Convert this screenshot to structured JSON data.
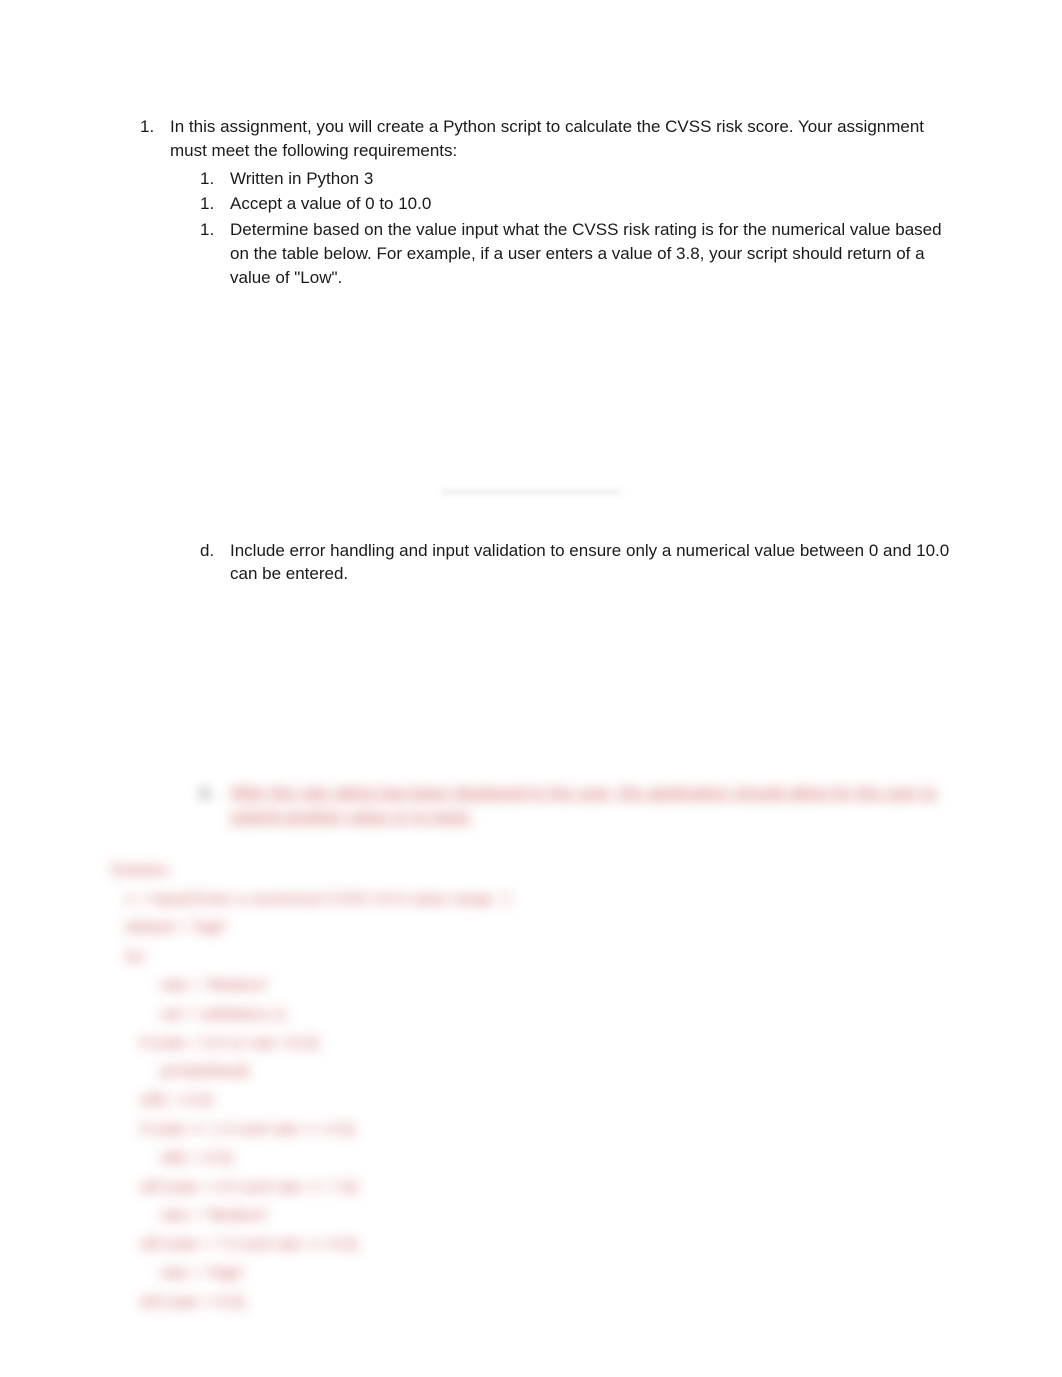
{
  "main": {
    "marker": "1.",
    "intro": "In this assignment, you will create a Python script to calculate the CVSS risk score. Your assignment must meet the following requirements:",
    "subs": [
      {
        "marker": "1.",
        "text": "Written in Python 3"
      },
      {
        "marker": "1.",
        "text": "Accept a value of 0 to 10.0"
      },
      {
        "marker": "1.",
        "text": "Determine based on the value input what the CVSS risk rating is for the numerical value based on the table below. For example, if a user enters a value of 3.8, your script should return of a value of \"Low\"."
      }
    ]
  },
  "section_d": {
    "marker": "d.",
    "text": "Include error handling and input validation to ensure only a numerical value between 0 and 10.0 can be entered."
  },
  "blurred_e": {
    "marker": "e.",
    "text": "After the rule rating has been displayed to the user, the application should allow for the user to submit another value or to input."
  },
  "code": {
    "lines": [
      {
        "indent": 0,
        "text": "Solution:"
      },
      {
        "indent": 1,
        "text": "x = input('Enter a numerical CVSS V3.0 value range :')"
      },
      {
        "indent": 1,
        "text": "default = 'high'"
      },
      {
        "indent": 1,
        "text": "try:"
      },
      {
        "indent": 3,
        "text": "rate = 'Medium'"
      },
      {
        "indent": 3,
        "text": "val = validate(x,1)"
      },
      {
        "indent": 2,
        "text": "if (rate = 0.0 or rate <0.0):"
      },
      {
        "indent": 3,
        "text": "print(default)"
      },
      {
        "indent": 2,
        "text": "elif( = 0.0):"
      },
      {
        "indent": 2,
        "text": "if (rate >= 1.0 and rate <= 4.0):"
      },
      {
        "indent": 3,
        "text": "elif( = 0.0):"
      },
      {
        "indent": 2,
        "text": "elif (rate > 4.0 and rate <= 7.0):"
      },
      {
        "indent": 3,
        "text": "rate = 'Medium'"
      },
      {
        "indent": 2,
        "text": "elif (rate > 7.0 and rate <= 9.0):"
      },
      {
        "indent": 3,
        "text": "rate = 'High'"
      },
      {
        "indent": 2,
        "text": "elif (rate > 9.0):"
      }
    ]
  }
}
